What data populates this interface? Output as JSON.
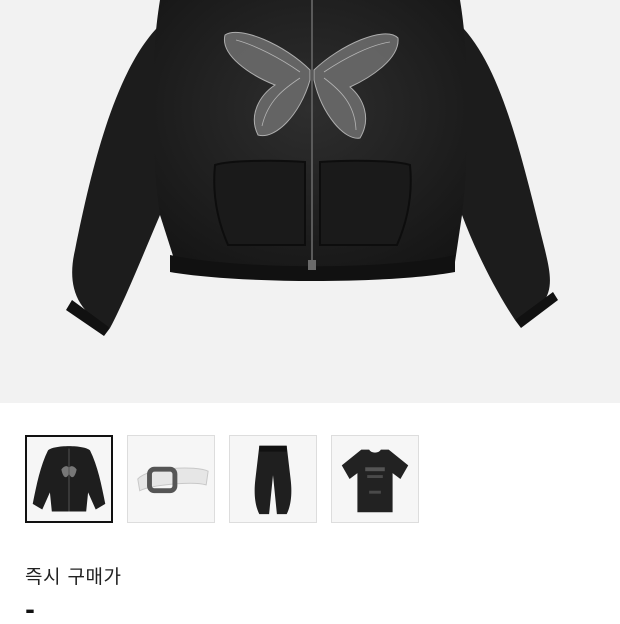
{
  "product": {
    "main_image": "black-butterfly-zip-hoodie",
    "selected_thumbnail": 0,
    "thumbnails": [
      {
        "name": "butterfly-zip-hoodie"
      },
      {
        "name": "white-leather-belt"
      },
      {
        "name": "black-washed-pants"
      },
      {
        "name": "black-graphic-tshirt"
      }
    ]
  },
  "price": {
    "label": "즉시 구매가",
    "value": "-"
  }
}
